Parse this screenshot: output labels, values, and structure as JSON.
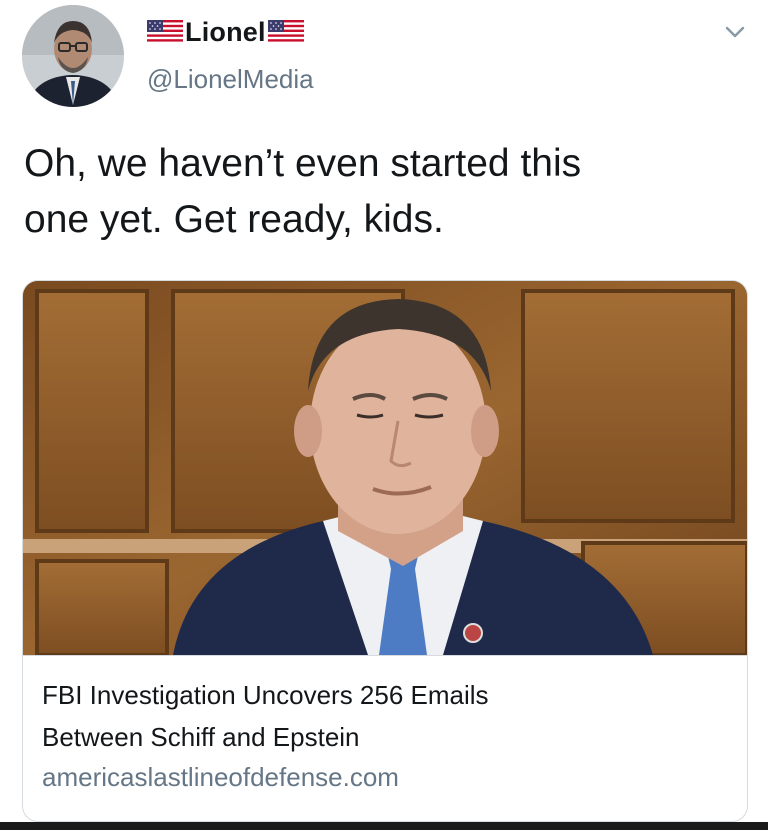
{
  "author": {
    "display_name": "Lionel",
    "handle": "@LionelMedia",
    "name_emoji_left": "us-flag-icon",
    "name_emoji_right": "us-flag-icon"
  },
  "tweet": {
    "text": "Oh, we haven’t even started this\none yet. Get ready, kids."
  },
  "card": {
    "title": "FBI Investigation Uncovers 256 Emails\nBetween Schiff and Epstein",
    "domain": "americaslastlineofdefense.com"
  },
  "colors": {
    "text_primary": "#14171a",
    "text_secondary": "#657786",
    "border": "#d6dbe0"
  }
}
